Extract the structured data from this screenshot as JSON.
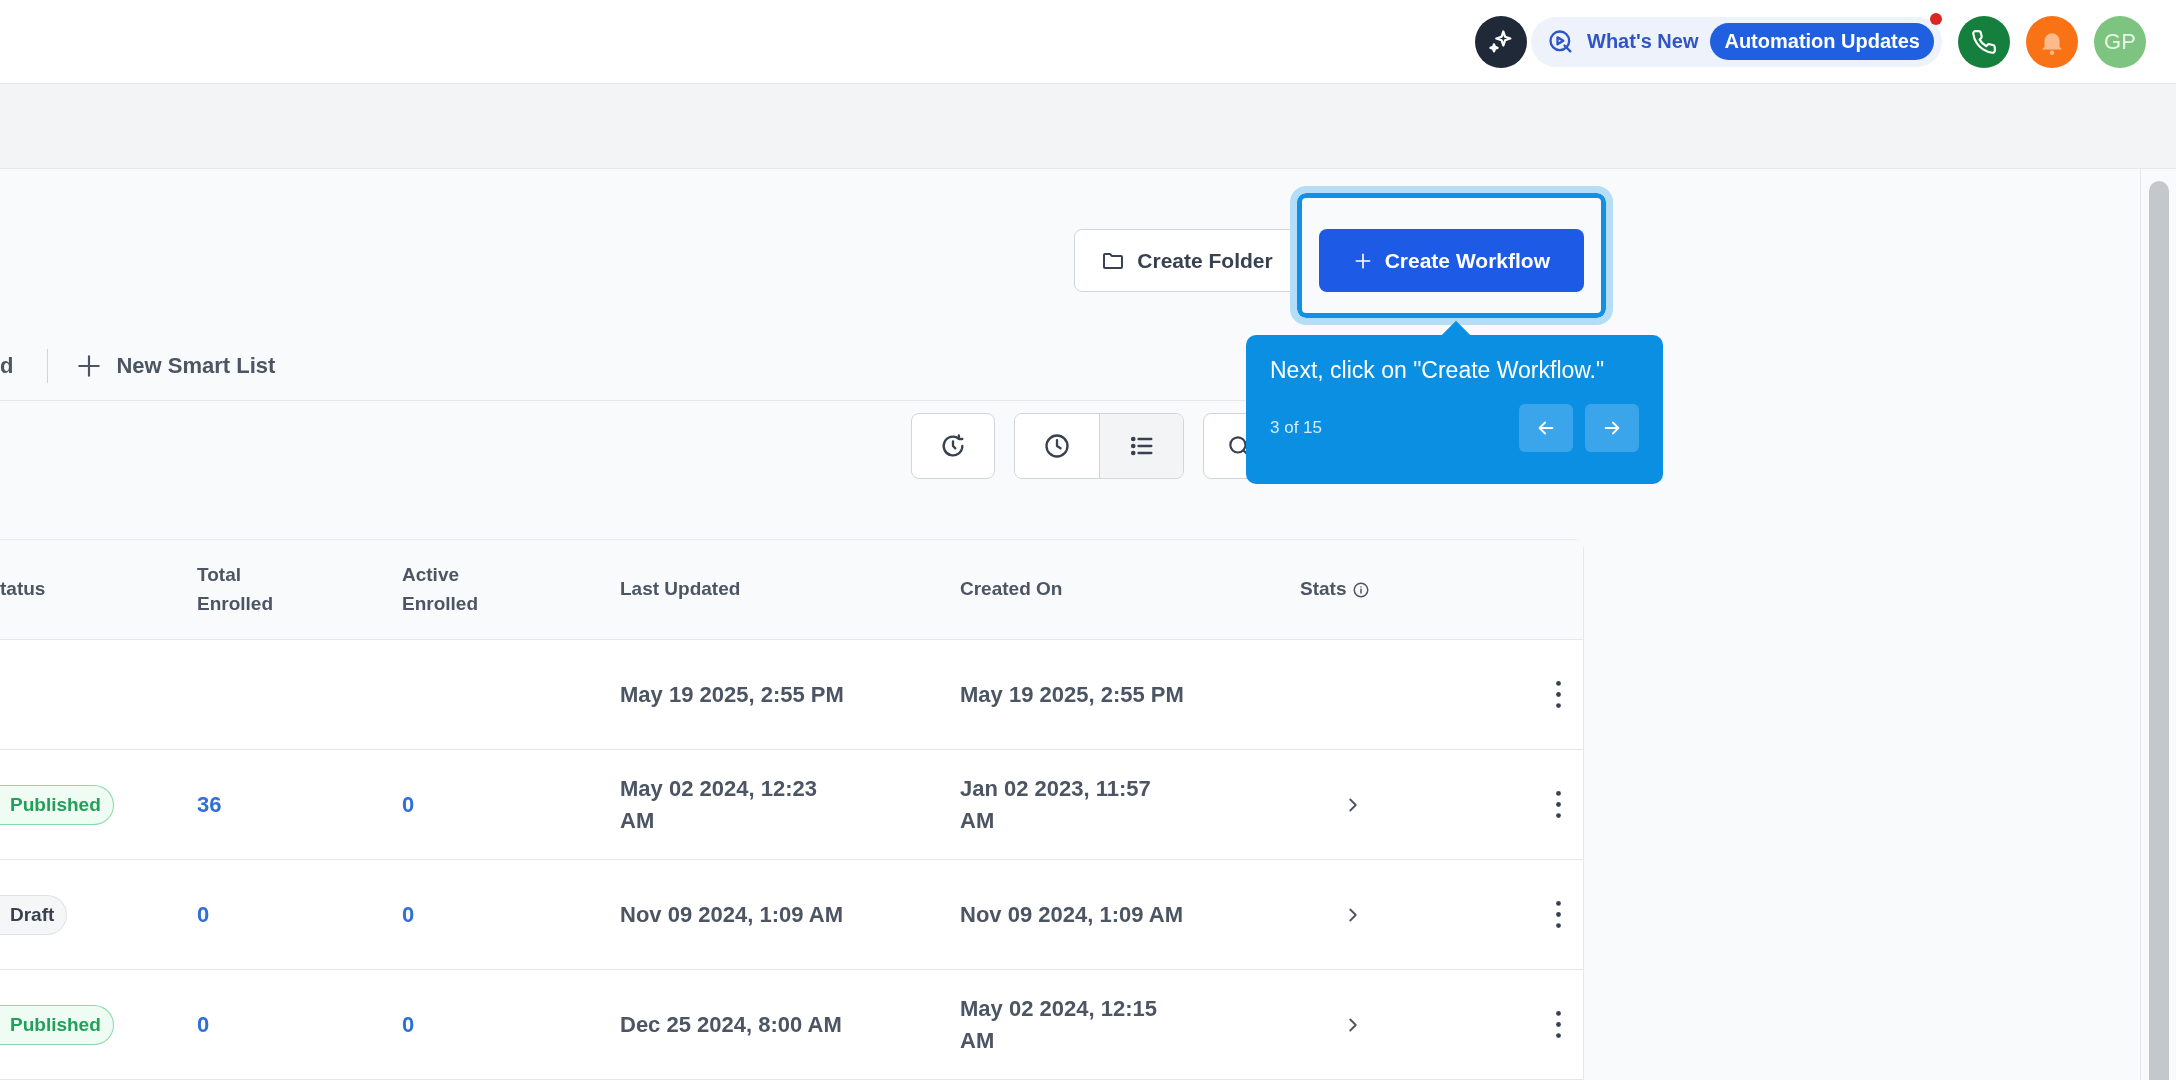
{
  "topbar": {
    "whats_new": "What's New",
    "badge": "Automation Updates",
    "badge_notification": true,
    "avatar": "GP"
  },
  "actions": {
    "create_folder": "Create Folder",
    "create_workflow": "Create Workflow"
  },
  "tabs": [
    {
      "label": "d",
      "kind": "tab"
    },
    {
      "label": "New Smart List",
      "kind": "add"
    }
  ],
  "view_toggle": [
    {
      "kind": "clock",
      "selected": false
    },
    {
      "kind": "list",
      "selected": true
    }
  ],
  "tour": {
    "text": "Next, click on \"Create Workflow.\"",
    "step": "3 of 15"
  },
  "table": {
    "columns": [
      "tatus",
      "Total Enrolled",
      "Active Enrolled",
      "Last Updated",
      "Created On",
      "Stats"
    ],
    "rows": [
      {
        "status": null,
        "total": null,
        "active": null,
        "last_updated": "May 19 2025, 2:55 PM",
        "created_on": "May 19 2025, 2:55 PM",
        "stats": false
      },
      {
        "status": {
          "label": "Published",
          "kind": "published"
        },
        "total": "36",
        "active": "0",
        "last_updated": "May 02 2024, 12:23 AM",
        "created_on": "Jan 02 2023, 11:57 AM",
        "stats": true
      },
      {
        "status": {
          "label": "Draft",
          "kind": "draft"
        },
        "total": "0",
        "active": "0",
        "last_updated": "Nov 09 2024, 1:09 AM",
        "created_on": "Nov 09 2024, 1:09 AM",
        "stats": true
      },
      {
        "status": {
          "label": "Published",
          "kind": "published"
        },
        "total": "0",
        "active": "0",
        "last_updated": "Dec 25 2024, 8:00 AM",
        "created_on": "May 02 2024, 12:15 AM",
        "stats": true
      }
    ]
  }
}
